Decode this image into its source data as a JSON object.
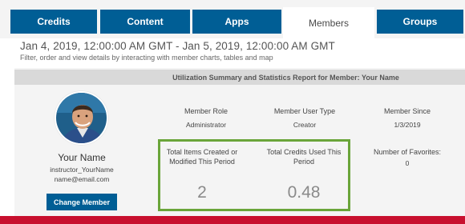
{
  "tabs": [
    {
      "label": "Credits"
    },
    {
      "label": "Content"
    },
    {
      "label": "Apps"
    },
    {
      "label": "Members"
    },
    {
      "label": "Groups"
    }
  ],
  "header": {
    "date_range": "Jan 4, 2019, 12:00:00 AM GMT - Jan 5, 2019, 12:00:00 AM GMT",
    "subtitle": "Filter, order and view details by interacting with member charts, tables and map"
  },
  "report": {
    "title": "Utilization Summary and Statistics Report for Member: Your Name"
  },
  "member": {
    "name": "Your Name",
    "username": "instructor_YourName",
    "email": "name@email.com",
    "change_button": "Change Member"
  },
  "stats": {
    "role_label": "Member Role",
    "role_value": "Administrator",
    "type_label": "Member User Type",
    "type_value": "Creator",
    "since_label": "Member Since",
    "since_value": "1/3/2019",
    "items_label": "Total Items Created or Modified This Period",
    "items_value": "2",
    "credits_label": "Total Credits Used This Period",
    "credits_value": "0.48",
    "favorites_label": "Number of Favorites:",
    "favorites_value": "0"
  },
  "colors": {
    "tab_blue": "#005e95",
    "highlight_green": "#6aa53a",
    "bottom_red": "#c8102e"
  }
}
